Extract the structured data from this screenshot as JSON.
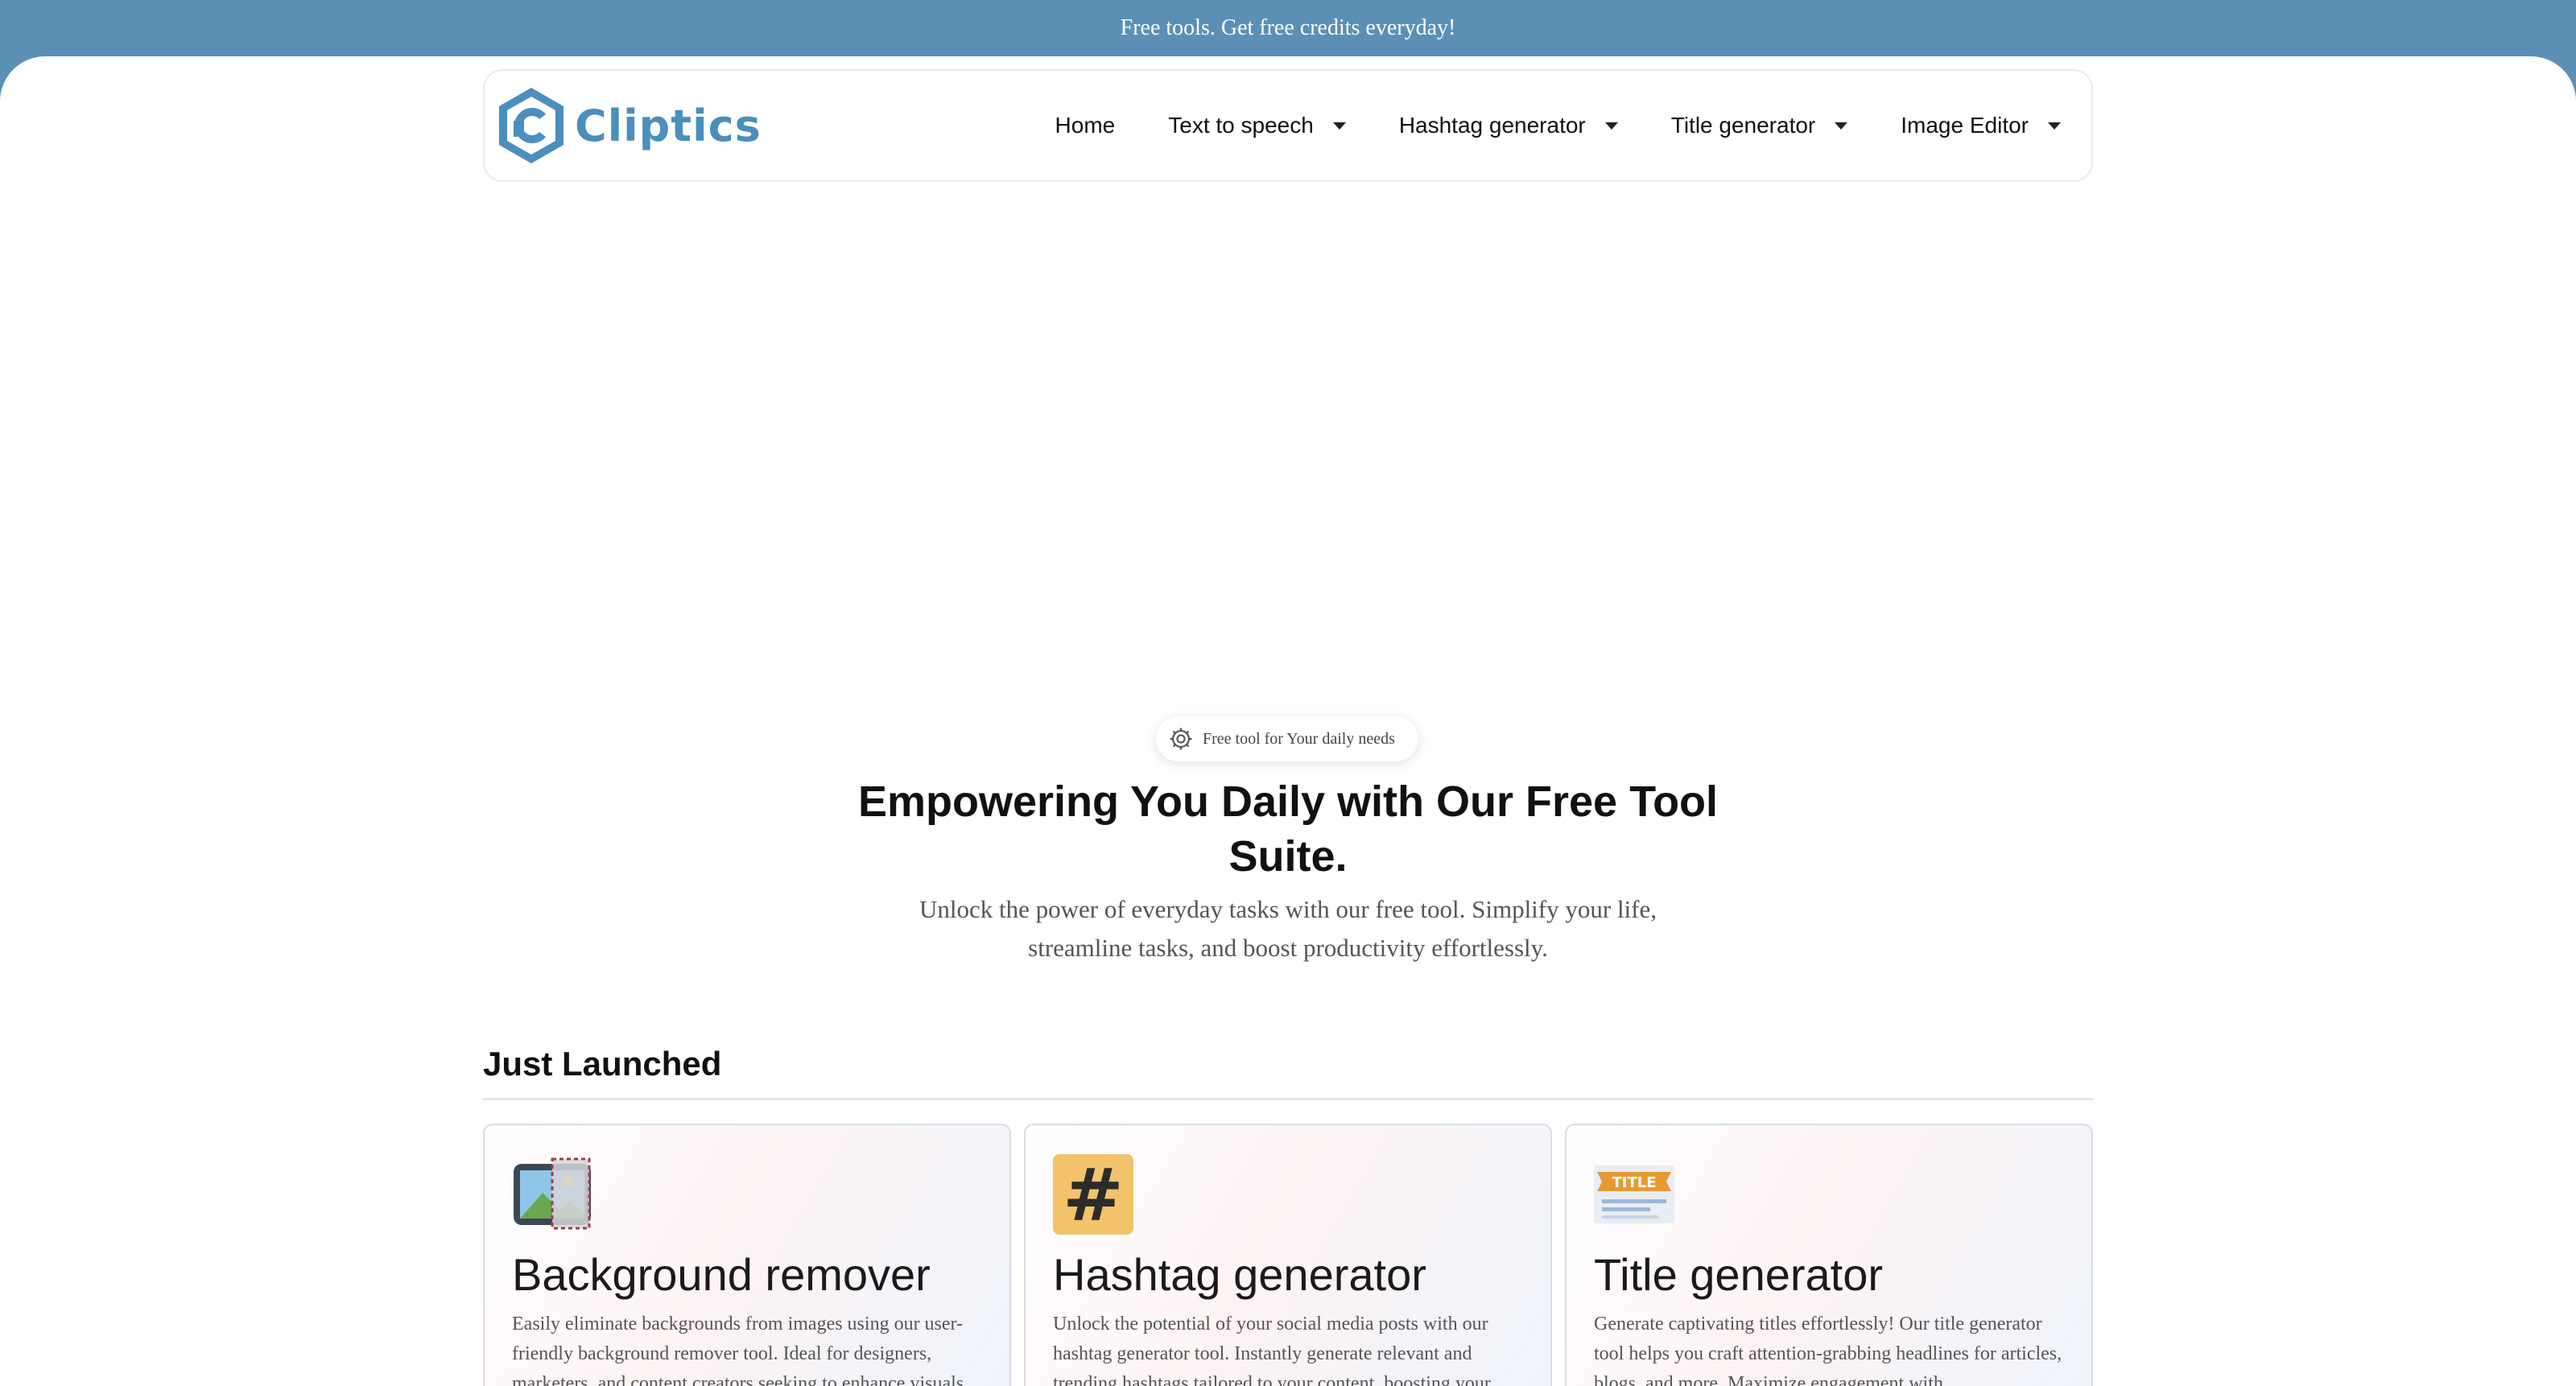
{
  "banner": {
    "text": "Free tools. Get free credits everyday!"
  },
  "brand": {
    "name": "Cliptics",
    "color": "#4a8fbd"
  },
  "nav": {
    "items": [
      {
        "label": "Home",
        "has_dropdown": false
      },
      {
        "label": "Text to speech",
        "has_dropdown": true
      },
      {
        "label": "Hashtag generator",
        "has_dropdown": true
      },
      {
        "label": "Title generator",
        "has_dropdown": true
      },
      {
        "label": "Image Editor",
        "has_dropdown": true
      }
    ]
  },
  "hero": {
    "pill_icon": "gear-icon",
    "pill_text": "Free tool for Your daily needs",
    "title": "Empowering You Daily with Our Free Tool Suite.",
    "subtitle": "Unlock the power of everyday tasks with our free tool. Simplify your life, streamline tasks, and boost productivity effortlessly."
  },
  "section": {
    "title": "Just Launched"
  },
  "cards": [
    {
      "icon": "image-crop-icon",
      "title": "Background remover",
      "description": "Easily eliminate backgrounds from images using our user-friendly background remover tool. Ideal for designers, marketers, and content creators seeking to enhance visuals."
    },
    {
      "icon": "hashtag-icon",
      "title": "Hashtag generator",
      "description": "Unlock the potential of your social media posts with our hashtag generator tool. Instantly generate relevant and trending hashtags tailored to your content, boosting your"
    },
    {
      "icon": "title-icon",
      "title": "Title generator",
      "description": "Generate captivating titles effortlessly! Our title generator tool helps you craft attention-grabbing headlines for articles, blogs, and more. Maximize engagement with"
    }
  ],
  "colors": {
    "banner": "#5b8fb6",
    "accent": "#4a8fbd"
  }
}
